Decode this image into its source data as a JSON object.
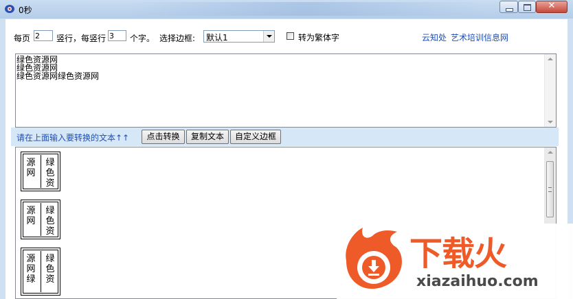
{
  "window": {
    "title": "0秒"
  },
  "controls": {
    "per_page_label": "每页",
    "per_page_value": "2",
    "columns_label": "竖行，每竖行",
    "chars_value": "3",
    "chars_label": "个字。",
    "border_label": "选择边框:",
    "border_selected": "默认1",
    "traditional_label": "转为繁体字",
    "link1": "云知处",
    "link2": "艺术培训信息网"
  },
  "input_text": {
    "lines": [
      "绿色资源网",
      "绿色资源网",
      "绿色资源网绿色资源网"
    ]
  },
  "toolbar": {
    "hint": "请在上面输入要转换的文本↑↑",
    "convert": "点击转换",
    "copy": "复制文本",
    "custom_border": "自定义边框"
  },
  "output": {
    "pages": [
      {
        "col1": "源网",
        "col2": "绿色资"
      },
      {
        "col1": "源网",
        "col2": "绿色资"
      },
      {
        "col1": "源网绿",
        "col2": "绿色资"
      }
    ]
  },
  "watermark": {
    "brand": "下载火",
    "site": "xiazaihuo.com"
  },
  "colors": {
    "link": "#1f4fb4",
    "accent": "#ee5a28"
  }
}
